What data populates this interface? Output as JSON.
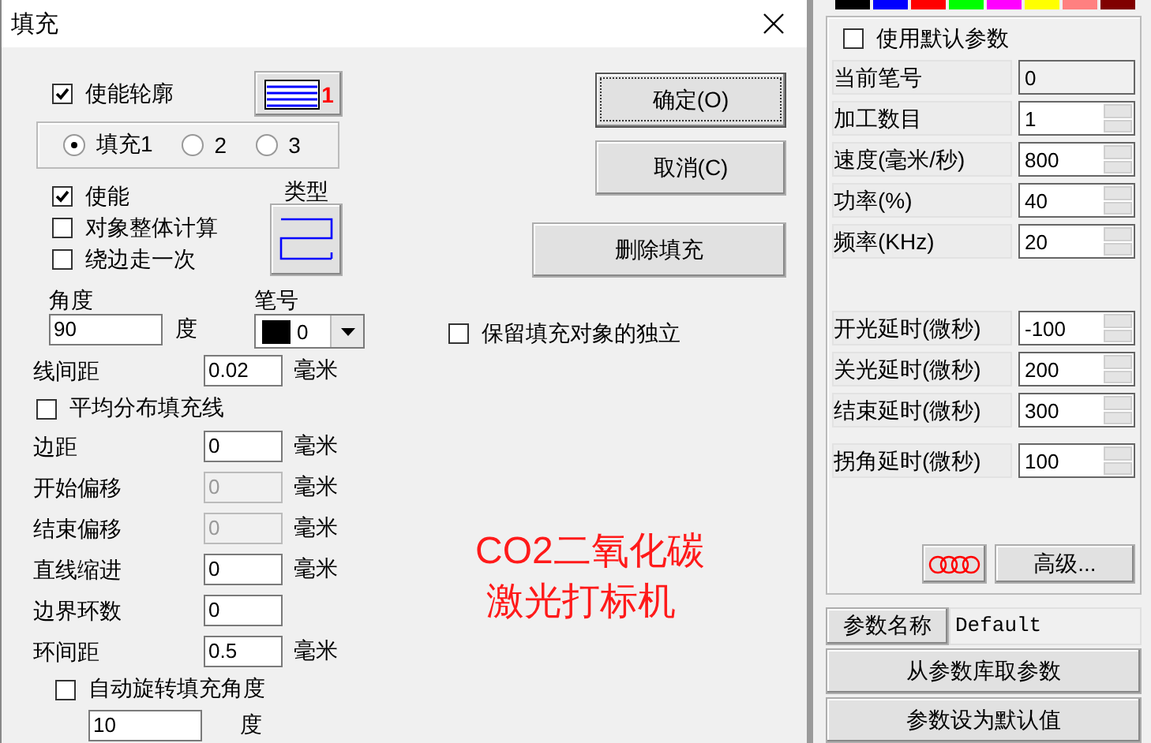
{
  "dialog": {
    "title": "填充",
    "outline": {
      "label": "使能轮廓",
      "checked": true
    },
    "pattern_index": "1",
    "fill_tabs": [
      {
        "label": "填充1",
        "selected": true
      },
      {
        "label": "2",
        "selected": false
      },
      {
        "label": "3",
        "selected": false
      }
    ],
    "options": [
      {
        "label": "使能",
        "checked": true
      },
      {
        "label": "对象整体计算",
        "checked": false
      },
      {
        "label": "绕边走一次",
        "checked": false
      }
    ],
    "type_label": "类型",
    "angle": {
      "label": "角度",
      "value": "90",
      "unit": "度"
    },
    "pen": {
      "label": "笔号",
      "value": "0"
    },
    "rows": [
      {
        "kind": "field",
        "label": "线间距",
        "value": "0.02",
        "unit": "毫米",
        "disabled": false
      },
      {
        "kind": "checkbox",
        "label": "平均分布填充线",
        "checked": false
      },
      {
        "kind": "field",
        "label": "边距",
        "value": "0",
        "unit": "毫米",
        "disabled": false
      },
      {
        "kind": "field",
        "label": "开始偏移",
        "value": "0",
        "unit": "毫米",
        "disabled": true
      },
      {
        "kind": "field",
        "label": "结束偏移",
        "value": "0",
        "unit": "毫米",
        "disabled": true
      },
      {
        "kind": "field",
        "label": "直线缩进",
        "value": "0",
        "unit": "毫米",
        "disabled": false
      },
      {
        "kind": "field",
        "label": "边界环数",
        "value": "0",
        "disabled": false
      },
      {
        "kind": "field",
        "label": "环间距",
        "value": "0.5",
        "unit": "毫米",
        "disabled": false
      },
      {
        "kind": "checkbox",
        "label": "自动旋转填充角度",
        "checked": false
      },
      {
        "kind": "subfield",
        "value": "10",
        "unit": "度"
      }
    ],
    "buttons": [
      {
        "label": "确定(O)",
        "default": true
      },
      {
        "label": "取消(C)",
        "default": false
      },
      {
        "label": "删除填充",
        "default": false
      }
    ],
    "keep_independent": {
      "label": "保留填充对象的独立",
      "checked": false
    },
    "caption": [
      "CO2二氧化碳",
      "激光打标机"
    ]
  },
  "params": {
    "swatches": [
      {
        "color": "#000000"
      },
      {
        "color": "#0000ff"
      },
      {
        "color": "#ff0000"
      },
      {
        "color": "#00ff00"
      },
      {
        "color": "#ff00ff"
      },
      {
        "color": "#ffff00"
      },
      {
        "color": "#ff8080"
      },
      {
        "color": "#800000"
      }
    ],
    "use_default": {
      "label": "使用默认参数",
      "checked": false
    },
    "rows": [
      {
        "label": "当前笔号",
        "value": "0",
        "spinner": false
      },
      {
        "label": "加工数目",
        "value": "1",
        "spinner": true
      },
      {
        "label": "速度(毫米/秒)",
        "value": "800",
        "spinner": true
      },
      {
        "label": "功率(%)",
        "value": "40",
        "spinner": true
      },
      {
        "label": "频率(KHz)",
        "value": "20",
        "spinner": true
      }
    ],
    "delay_rows": [
      {
        "label": "开光延时(微秒)",
        "value": "-100",
        "spinner": true
      },
      {
        "label": "关光延时(微秒)",
        "value": "200",
        "spinner": true
      },
      {
        "label": "结束延时(微秒)",
        "value": "300",
        "spinner": true
      },
      {
        "label": "拐角延时(微秒)",
        "value": "100",
        "spinner": true
      }
    ],
    "advanced": "高级...",
    "name_label": "参数名称",
    "name_value": "Default",
    "actions": [
      "从参数库取参数",
      "参数设为默认值"
    ]
  }
}
